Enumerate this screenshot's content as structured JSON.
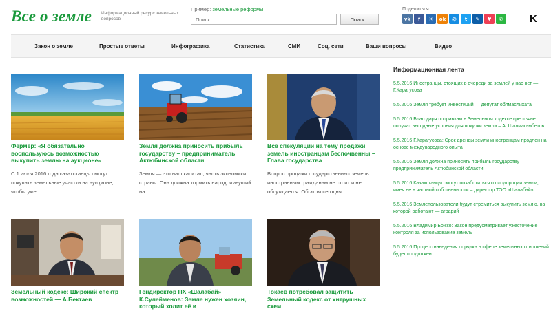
{
  "header": {
    "logo": "Все о земле",
    "tagline": "Информационный ресурс земельных вопросов",
    "example_prefix": "Пример:",
    "example_link": "земельные реформы",
    "search_placeholder": "Поиск...",
    "search_button": "Поиск...",
    "share_label": "Поделиться",
    "share_icons": [
      "vk",
      "facebook",
      "twitter",
      "odnoklassniki",
      "moimir",
      "twitter",
      "livejournal",
      "pocket",
      "whatsapp"
    ],
    "corner_letter": "K"
  },
  "nav": {
    "items": [
      "Закон о земле",
      "Простые ответы",
      "Инфографика",
      "Статистика",
      "СМИ",
      "Соц. сети",
      "Ваши вопросы",
      "Видео"
    ]
  },
  "cards": [
    {
      "title": "Фермер: «Я обязательно воспользуюсь возможностью выкупить землю на аукционе»",
      "text": "С 1 июля 2016 года казахстанцы смогут покупать земельные участки на аукционе, чтобы уже ..."
    },
    {
      "title": "Земля должна приносить прибыль государству – предприниматель Актюбинской области",
      "text": "Земля — это наш капитал, часть экономики страны. Она должна кормить народ, живущий на ..."
    },
    {
      "title": "Все спекуляции на тему продажи земель иностранцам беспочвенны – Глава государства",
      "text": "Вопрос продажи государственных земель иностранным гражданам не стоит и не обсуждается. Об этом сегодня..."
    },
    {
      "title": "Земельный кодекс: Широкий спектр возможностей — А.Бектаев",
      "text": ""
    },
    {
      "title": "Гендиректор ПХ «Шалабай» К.Сулейменов: Земле нужен хозяин, который холит её и",
      "text": ""
    },
    {
      "title": "Токаев потребовал защитить Земельный кодекс от хитрушных схем",
      "text": ""
    }
  ],
  "feed": {
    "title": "Информационная лента",
    "items": [
      {
        "date": "5.5.2016",
        "text": "Иностранцы, стоящих в очереди за землей у нас нет — Г.Карагусова"
      },
      {
        "date": "5.5.2016",
        "text": "Земля требует инвестиций — депутат облмаслихата"
      },
      {
        "date": "5.5.2016",
        "text": "Благодаря поправкам в Земельном кодексе крестьяне получат выгодные условия для покупки земли – А. Шалмагамбетов"
      },
      {
        "date": "5.5.2016",
        "text": "Г.Карагусова: Срок аренды земли иностранцам продлен на основе международного опыта"
      },
      {
        "date": "5.5.2016",
        "text": "Земля должна приносить прибыль государству – предприниматель Актюбинской области"
      },
      {
        "date": "5.5.2016",
        "text": "Казахстанцы смогут позаботиться о плодородии земли, имея ее в частной собственности – директор ТОО «Шалабай»"
      },
      {
        "date": "5.5.2016",
        "text": "Землепользователи будут стремиться выкупить землю, на которой работают — аграрий"
      },
      {
        "date": "5.5.2016",
        "text": "Владимир Божко: Закон предусматривает ужесточение контроля за использование земель"
      },
      {
        "date": "5.5.2016",
        "text": "Процесс наведения порядка в сфере земельных отношений будет продолжен"
      }
    ]
  },
  "colors": {
    "accent": "#1a9a3c",
    "nav_bg": "#f4f4f4"
  }
}
